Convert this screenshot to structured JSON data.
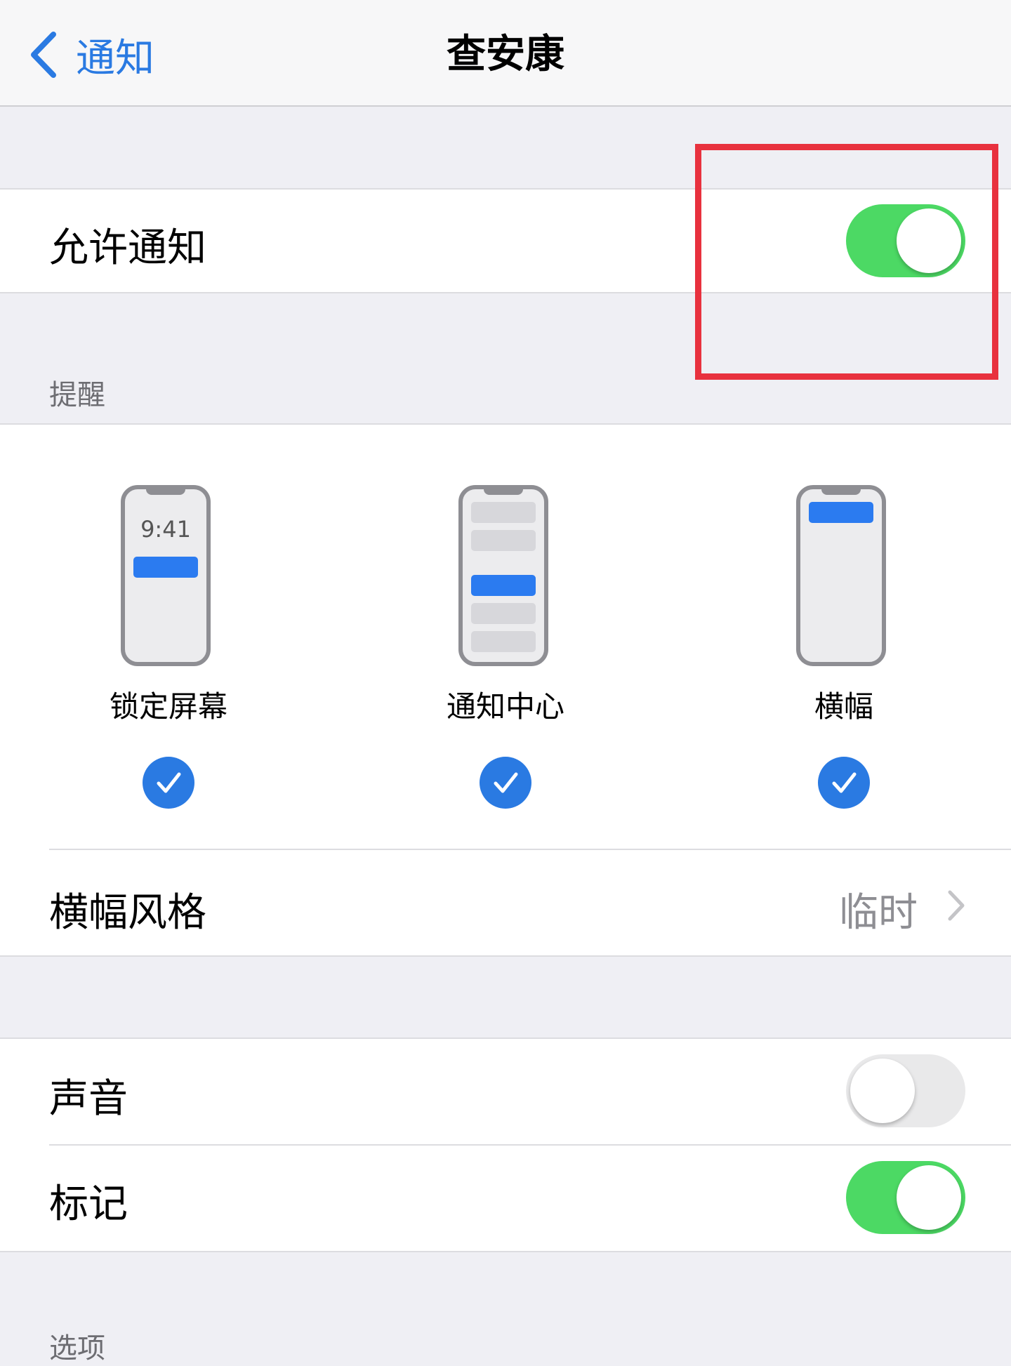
{
  "nav": {
    "back_label": "通知",
    "title": "查安康"
  },
  "allow": {
    "label": "允许通知",
    "state": "on"
  },
  "alerts": {
    "header": "提醒",
    "clock_text": "9:41",
    "styles": [
      {
        "label": "锁定屏幕",
        "checked": true
      },
      {
        "label": "通知中心",
        "checked": true
      },
      {
        "label": "横幅",
        "checked": true
      }
    ],
    "banner_style": {
      "label": "横幅风格",
      "value": "临时"
    }
  },
  "sound": {
    "label": "声音",
    "state": "off"
  },
  "badges": {
    "label": "标记",
    "state": "on"
  },
  "options": {
    "header": "选项"
  },
  "colors": {
    "accent": "#2a7ae2",
    "switch_on": "#4cd964",
    "highlight": "#e8313e"
  }
}
